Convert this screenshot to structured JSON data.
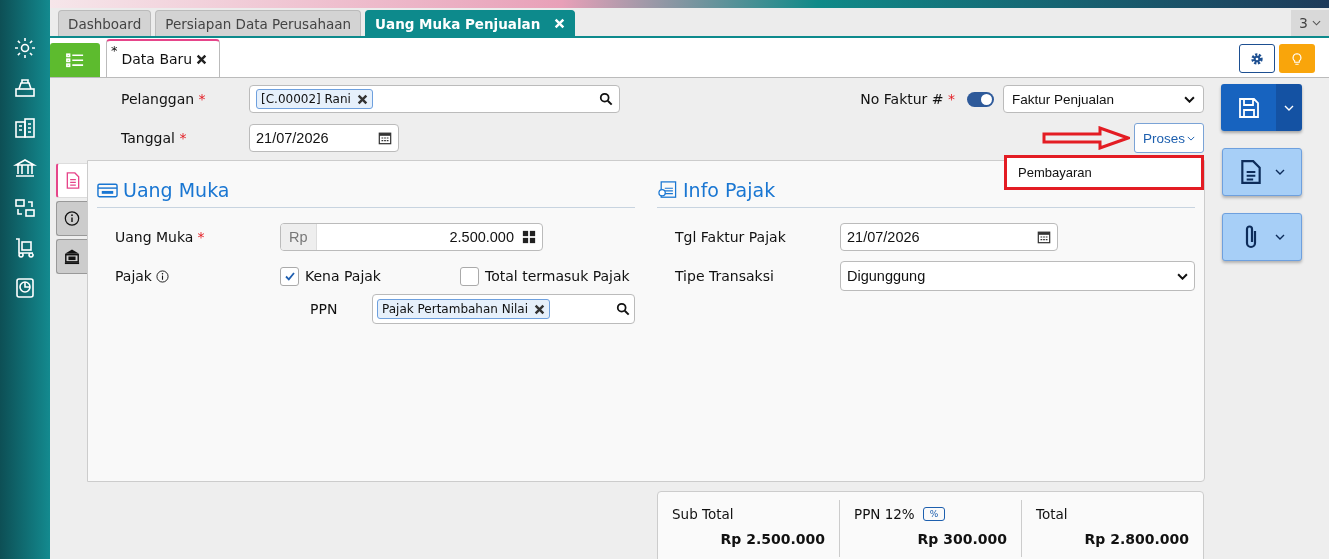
{
  "app_tabs": [
    {
      "label": "Dashboard",
      "selected": false
    },
    {
      "label": "Persiapan Data Perusahaan",
      "selected": false
    },
    {
      "label": "Uang Muka Penjualan",
      "selected": true
    }
  ],
  "tab_count": "3",
  "doc_tabs": [
    {
      "marker": "*",
      "label": "Data Baru",
      "selected": true
    }
  ],
  "header": {
    "customer": {
      "label": "Pelanggan",
      "required_mark": "*",
      "tag": "[C.00002] Rani"
    },
    "date": {
      "label": "Tanggal",
      "required_mark": "*",
      "value": "21/07/2026"
    },
    "invoice_no": {
      "label": "No Faktur #",
      "required_mark": "*",
      "on": true,
      "value": "Faktur Penjualan"
    },
    "process_button": "Proses",
    "process_menu": [
      "Pembayaran"
    ]
  },
  "side_tabs": [
    {
      "kind": "document",
      "selected": true
    },
    {
      "kind": "info",
      "selected": false
    },
    {
      "kind": "bank",
      "selected": false
    }
  ],
  "down_payment": {
    "title": "Uang Muka",
    "amount": {
      "label": "Uang Muka",
      "required_mark": "*",
      "prefix": "Rp",
      "value": "2.500.000"
    },
    "tax": {
      "label": "Pajak",
      "options": [
        {
          "label": "Kena Pajak",
          "checked": true
        },
        {
          "label": "Total termasuk Pajak",
          "checked": false
        }
      ]
    },
    "ppn": {
      "label": "PPN",
      "tag": "Pajak Pertambahan Nilai"
    }
  },
  "tax_info": {
    "title": "Info Pajak",
    "date": {
      "label": "Tgl Faktur Pajak",
      "value": "21/07/2026"
    },
    "type": {
      "label": "Tipe Transaksi",
      "value": "Digunggung"
    }
  },
  "summary": [
    {
      "label": "Sub Total",
      "value": "Rp 2.500.000"
    },
    {
      "label": "PPN 12%",
      "badge": "%",
      "value": "Rp 300.000"
    },
    {
      "label": "Total",
      "value": "Rp 2.800.000"
    }
  ]
}
